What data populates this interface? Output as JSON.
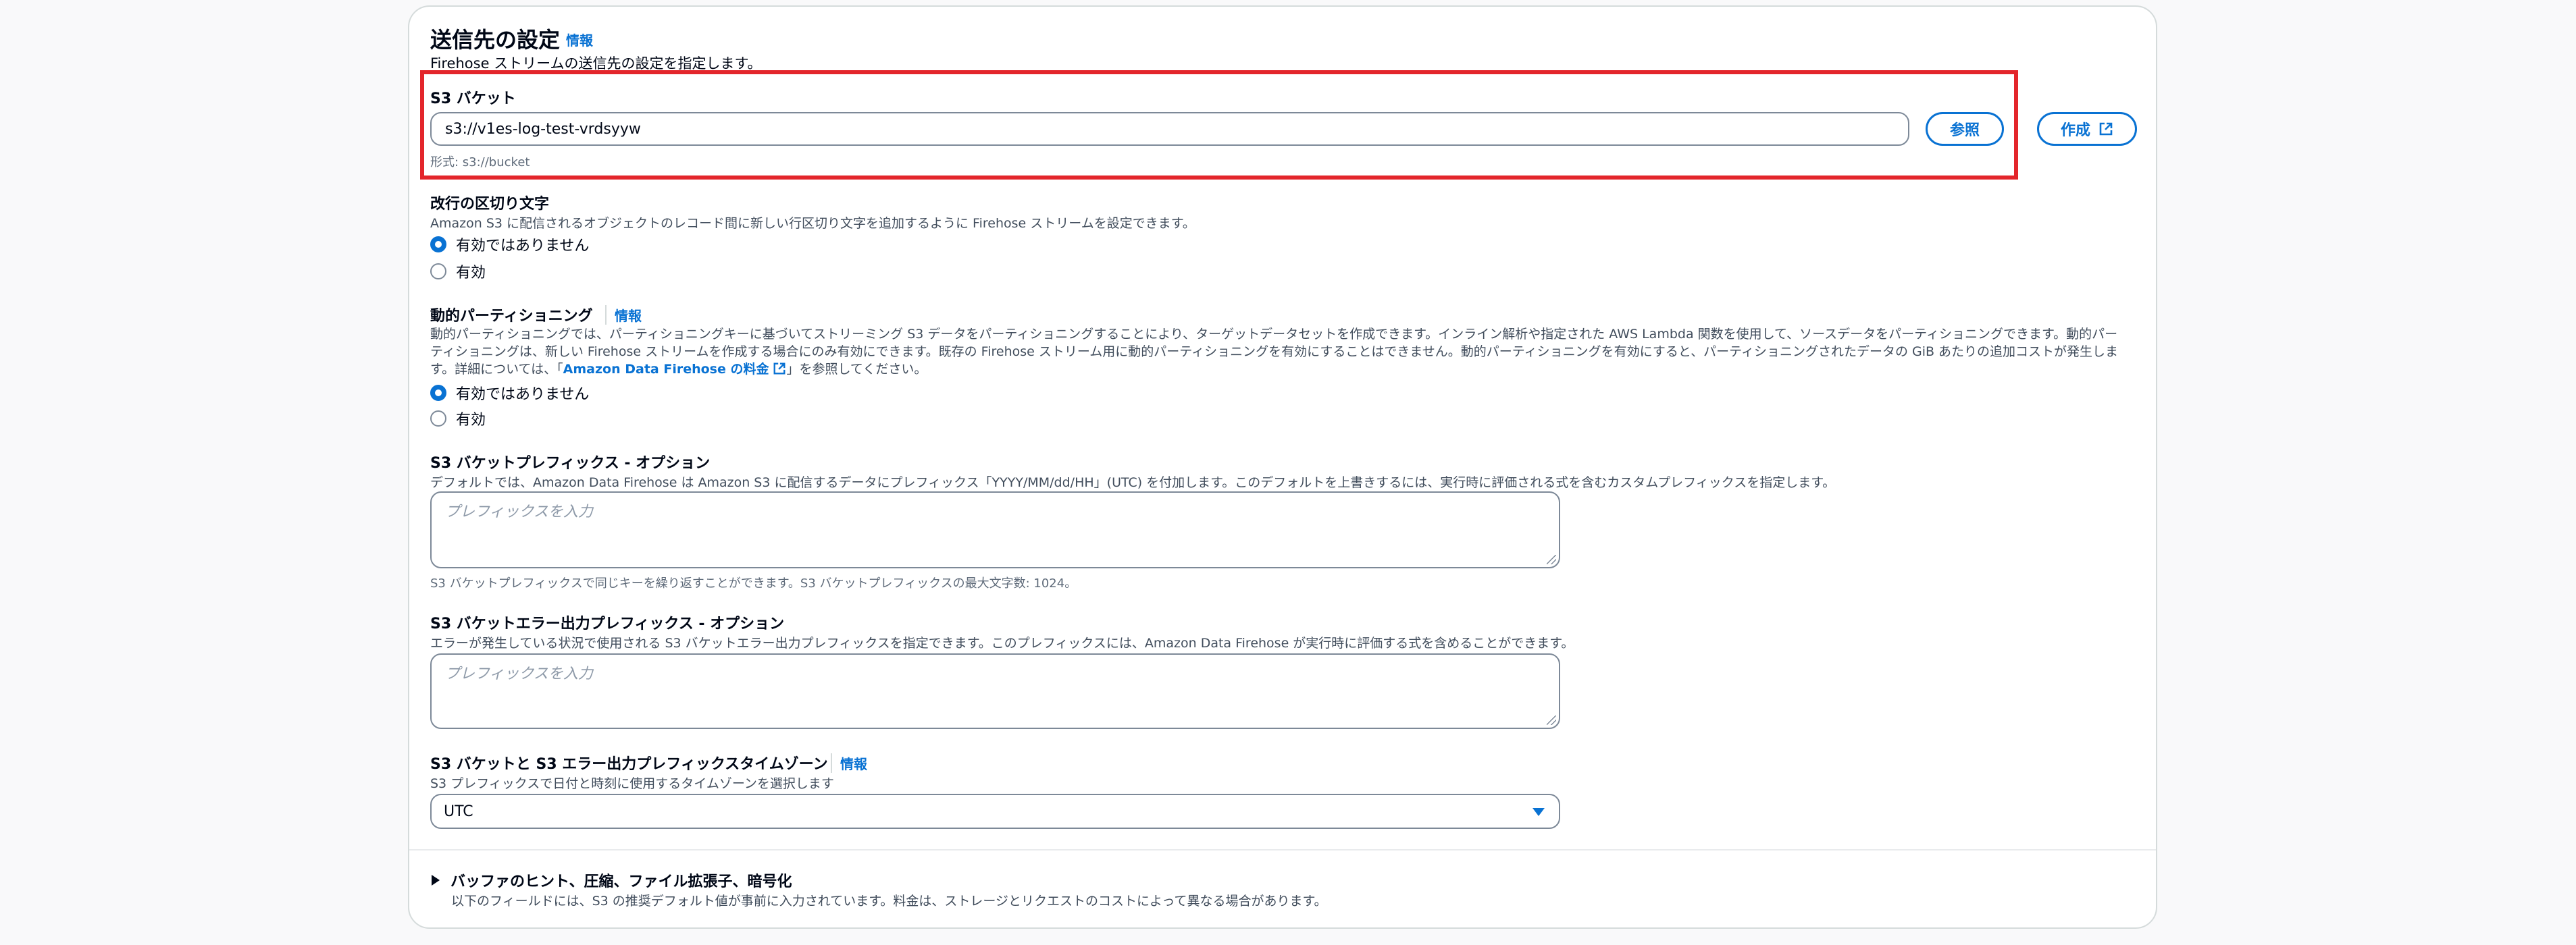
{
  "section": {
    "title": "送信先の設定",
    "info_label": "情報",
    "description": "Firehose ストリームの送信先の設定を指定します。"
  },
  "s3_bucket": {
    "label": "S3 バケット",
    "value": "s3://v1es-log-test-vrdsyyw",
    "browse_label": "参照",
    "create_label": "作成",
    "hint": "形式: s3://bucket"
  },
  "newline_delimiter": {
    "label": "改行の区切り文字",
    "description": "Amazon S3 に配信されるオブジェクトのレコード間に新しい行区切り文字を追加するように Firehose ストリームを設定できます。",
    "options": [
      "有効ではありません",
      "有効"
    ],
    "selected": "有効ではありません"
  },
  "dynamic_partitioning": {
    "label": "動的パーティショニング",
    "info_label": "情報",
    "description_line1": "動的パーティショニングでは、パーティショニングキーに基づいてストリーミング S3 データをパーティショニングすることにより、ターゲットデータセットを作成できます。インライン解析や指定された AWS Lambda 関数を使用して、ソースデータをパーティショニングできます。動的パー",
    "description_line2": "ティショニングは、新しい Firehose ストリームを作成する場合にのみ有効にできます。既存の Firehose ストリーム用に動的パーティショニングを有効にすることはできません。動的パーティショニングを有効にすると、パーティショニングされたデータの GiB あたりの追加コストが発生しま",
    "description_line3_prefix": "す。詳細については、「",
    "pricing_link": "Amazon Data Firehose の料金",
    "description_line3_suffix": "」を参照してください。",
    "options": [
      "有効ではありません",
      "有効"
    ],
    "selected": "有効ではありません"
  },
  "s3_prefix": {
    "label": "S3 バケットプレフィックス - オプション",
    "description": "デフォルトでは、Amazon Data Firehose は Amazon S3 に配信するデータにプレフィックス「YYYY/MM/dd/HH」(UTC) を付加します。このデフォルトを上書きするには、実行時に評価される式を含むカスタムプレフィックスを指定します。",
    "placeholder": "プレフィックスを入力",
    "hint": "S3 バケットプレフィックスで同じキーを繰り返すことができます。S3 バケットプレフィックスの最大文字数: 1024。"
  },
  "s3_error_prefix": {
    "label": "S3 バケットエラー出力プレフィックス - オプション",
    "description": "エラーが発生している状況で使用される S3 バケットエラー出力プレフィックスを指定できます。このプレフィックスには、Amazon Data Firehose が実行時に評価する式を含めることができます。",
    "placeholder": "プレフィックスを入力"
  },
  "timezone": {
    "label": "S3 バケットと S3 エラー出力プレフィックスタイムゾーン",
    "info_label": "情報",
    "description": "S3 プレフィックスで日付と時刻に使用するタイムゾーンを選択します",
    "selected": "UTC"
  },
  "buffer_hints": {
    "title": "バッファのヒント、圧縮、ファイル拡張子、暗号化",
    "description": "以下のフィールドには、S3 の推奨デフォルト値が事前に入力されています。料金は、ストレージとリクエストのコストによって異なる場合があります。"
  },
  "colors": {
    "accent": "#0972d3",
    "highlight_box": "#e3262b",
    "border": "#7d8998"
  }
}
